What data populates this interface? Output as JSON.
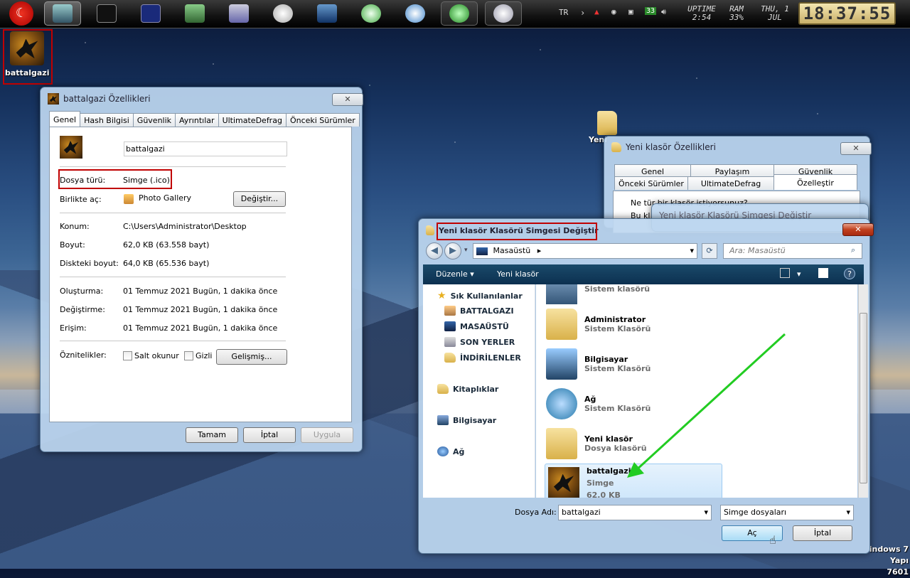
{
  "taskbar": {
    "lang": "TR",
    "uptime_label": "UPTIME",
    "uptime_value": "2:54",
    "ram_label": "RAM",
    "ram_value": "33%",
    "date_day": "THU, 1",
    "date_month": "JUL",
    "clock": "18:37:55",
    "tray_badge": "33"
  },
  "desktop": {
    "icon_label": "battalgazi",
    "folder_label": "Yeni",
    "watermark_line1": "indows 7",
    "watermark_line2": "Yapı 7601"
  },
  "props": {
    "title": "battalgazi Özellikleri",
    "close": "✕",
    "tabs": [
      "Genel",
      "Hash Bilgisi",
      "Güvenlik",
      "Ayrıntılar",
      "UltimateDefrag",
      "Önceki Sürümler"
    ],
    "name_value": "battalgazi",
    "file_type_label": "Dosya türü:",
    "file_type_value": "Simge (.ico)",
    "open_with_label": "Birlikte aç:",
    "open_with_value": "Photo Gallery",
    "change_button": "Değiştir...",
    "location_label": "Konum:",
    "location_value": "C:\\Users\\Administrator\\Desktop",
    "size_label": "Boyut:",
    "size_value": "62,0 KB (63.558 bayt)",
    "disk_size_label": "Diskteki boyut:",
    "disk_size_value": "64,0 KB (65.536 bayt)",
    "created_label": "Oluşturma:",
    "created_value": "01 Temmuz 2021 Bugün, 1 dakika önce",
    "modified_label": "Değiştirme:",
    "modified_value": "01 Temmuz 2021 Bugün, 1 dakika önce",
    "accessed_label": "Erişim:",
    "accessed_value": "01 Temmuz 2021 Bugün, 1 dakika önce",
    "attrs_label": "Öznitelikler:",
    "readonly_label": "Salt okunur",
    "hidden_label": "Gizli",
    "advanced_button": "Gelişmiş...",
    "ok": "Tamam",
    "cancel": "İptal",
    "apply": "Uygula"
  },
  "folder_props": {
    "title": "Yeni klasör Özellikleri",
    "close": "✕",
    "tabs_row1": [
      "Genel",
      "Paylaşım",
      "Güvenlik"
    ],
    "tabs_row2": [
      "Önceki Sürümler",
      "UltimateDefrag",
      "Özelleştir"
    ],
    "question": "Ne tür bir klasör istiyorsunuz?",
    "peek": "Bu kl",
    "hidden_title": "Yeni klasör Klasörü Simgesi Değiştir"
  },
  "dialog": {
    "title": "Yeni klasör Klasörü Simgesi Değiştir",
    "close": "✕",
    "address": "Masaüstü",
    "search_placeholder": "Ara: Masaüstü",
    "organize": "Düzenle ▾",
    "new_folder": "Yeni klasör",
    "help": "?",
    "nav": {
      "favorites": "Sık Kullanılanlar",
      "items": [
        "BATTALGAZI",
        "MASAÜSTÜ",
        "SON YERLER",
        "İNDİRİLENLER"
      ],
      "libraries": "Kitaplıklar",
      "computer": "Bilgisayar",
      "network": "Ağ"
    },
    "files": [
      {
        "name": "Sistem klasörü",
        "sub": ""
      },
      {
        "name": "Administrator",
        "sub": "Sistem Klasörü"
      },
      {
        "name": "Bilgisayar",
        "sub": "Sistem Klasörü"
      },
      {
        "name": "Ağ",
        "sub": "Sistem Klasörü"
      },
      {
        "name": "Yeni klasör",
        "sub": "Dosya klasörü"
      },
      {
        "name": "battalgazi",
        "sub": "Simge",
        "size": "62,0 KB"
      }
    ],
    "filename_label": "Dosya Adı:",
    "filename_value": "battalgazi",
    "filter_value": "Simge dosyaları",
    "open": "Aç",
    "cancel": "İptal"
  },
  "colors": {
    "highlight": "#c00000",
    "arrow": "#22cc22"
  }
}
